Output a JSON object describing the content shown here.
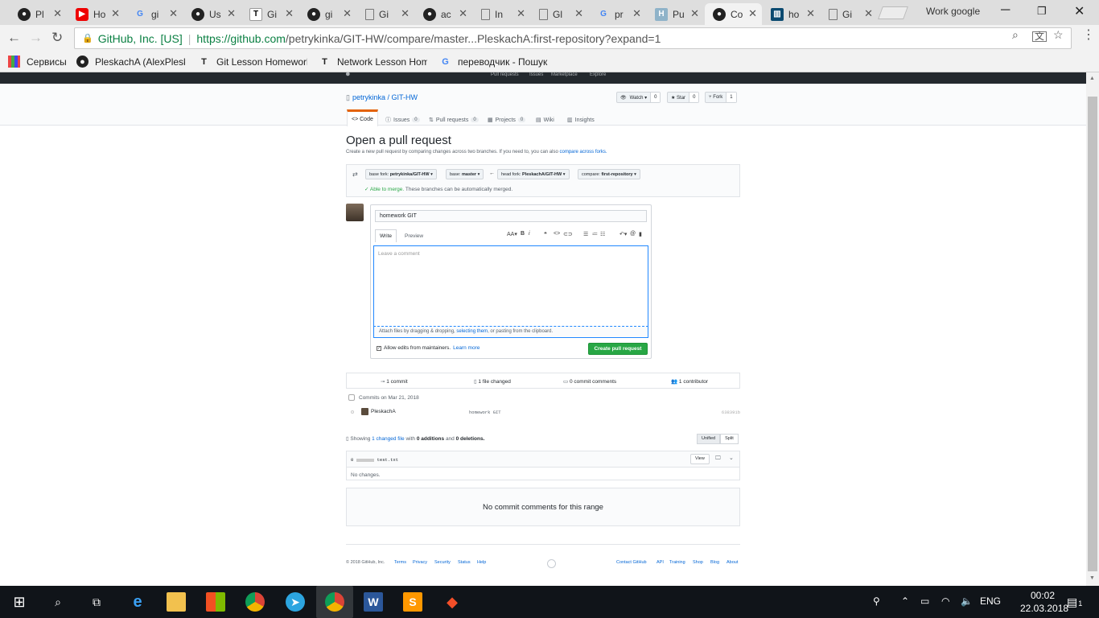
{
  "browser": {
    "tabs": [
      {
        "title": "Pl",
        "icon": "github-icon"
      },
      {
        "title": "Ho",
        "icon": "youtube-icon"
      },
      {
        "title": "gi",
        "icon": "google-icon"
      },
      {
        "title": "Us",
        "icon": "github-icon"
      },
      {
        "title": "Gi",
        "icon": "typora-icon"
      },
      {
        "title": "gi",
        "icon": "github-icon"
      },
      {
        "title": "Gi",
        "icon": "document-icon"
      },
      {
        "title": "ac",
        "icon": "github-icon"
      },
      {
        "title": "In",
        "icon": "document-icon"
      },
      {
        "title": "Gl",
        "icon": "document-icon"
      },
      {
        "title": "pr",
        "icon": "google-icon"
      },
      {
        "title": "Pu",
        "icon": "h-icon"
      },
      {
        "title": "Co",
        "icon": "github-icon"
      },
      {
        "title": "ho",
        "icon": "trello-icon"
      },
      {
        "title": "Gi",
        "icon": "document-icon"
      }
    ],
    "profile_name": "Work google",
    "address_org": "GitHub, Inc. [US]",
    "address_url_prefix": "https://github.com",
    "address_url_path": "/petrykinka/GIT-HW/compare/master...PleskachA:first-repository?expand=1",
    "bookmarks": [
      {
        "label": "Сервисы",
        "icon": "apps-icon"
      },
      {
        "label": "PleskachA (AlexPleska",
        "icon": "github-icon"
      },
      {
        "label": "Git Lesson Homework",
        "icon": "typora-icon"
      },
      {
        "label": "Network Lesson Hom",
        "icon": "typora-icon"
      },
      {
        "label": "переводчик - Пошук",
        "icon": "google-icon"
      }
    ]
  },
  "github": {
    "header_links": [
      "Pull requests",
      "Issues",
      "Marketplace",
      "Explore"
    ],
    "repo_owner": "petrykinka",
    "repo_sep": " / ",
    "repo_name": "GIT-HW",
    "watch": {
      "label": "Watch ▾",
      "count": "0"
    },
    "star": {
      "label": "★ Star",
      "count": "0"
    },
    "fork": {
      "label": "Fork",
      "count": "1"
    },
    "tabs": [
      {
        "label": "<> Code",
        "count": ""
      },
      {
        "label": "Issues",
        "count": "0"
      },
      {
        "label": "Pull requests",
        "count": "0"
      },
      {
        "label": "Projects",
        "count": "0"
      },
      {
        "label": "Wiki",
        "count": ""
      },
      {
        "label": "Insights",
        "count": ""
      }
    ],
    "pr_title": "Open a pull request",
    "pr_subtitle": "Create a new pull request by comparing changes across two branches. If you need to, you can also",
    "pr_subtitle_link": "compare across forks.",
    "base_fork_label": "base fork:",
    "base_fork": "petrykinka/GIT-HW",
    "base_label": "base:",
    "base": "master",
    "head_fork_label": "head fork:",
    "head_fork": "PleskachA/GIT-HW",
    "compare_label": "compare:",
    "compare": "first-repository",
    "merge_status": "✓ Able to merge.",
    "merge_text": "These branches can be automatically merged.",
    "title_value": "homework GIT",
    "write_tab": "Write",
    "preview_tab": "Preview",
    "comment_placeholder": "Leave a comment",
    "attach_text": "Attach files by dragging & dropping,",
    "attach_link": "selecting them",
    "attach_rest": ", or pasting from the clipboard.",
    "allow_edits": "Allow edits from maintainers.",
    "learn_more": "Learn more",
    "create_button": "Create pull request",
    "commits_count": "1 commit",
    "files_changed": "1 file changed",
    "commit_comments": "0 commit comments",
    "contributors": "1 contributor",
    "commits_date": "Commits on Mar 21, 2018",
    "commit_author": "PleskachA",
    "commit_message": "homework GIT",
    "commit_sha": "638391b",
    "showing_prefix": "Showing",
    "showing_link": "1 changed file",
    "showing_mid": "with",
    "additions": "0 additions",
    "and": "and",
    "deletions": "0 deletions.",
    "unified_label": "Unified",
    "split_label": "Split",
    "file_count": "0",
    "file_name": "test.txt",
    "view_label": "View",
    "no_changes": "No changes.",
    "no_commit_comments": "No commit comments for this range",
    "footer_left": [
      "© 2018 GitHub, Inc.",
      "Terms",
      "Privacy",
      "Security",
      "Status",
      "Help"
    ],
    "footer_right": [
      "Contact GitHub",
      "API",
      "Training",
      "Shop",
      "Blog",
      "About"
    ]
  },
  "taskbar": {
    "language": "ENG",
    "time": "00:02",
    "date": "22.03.2018",
    "notifications": "1"
  }
}
